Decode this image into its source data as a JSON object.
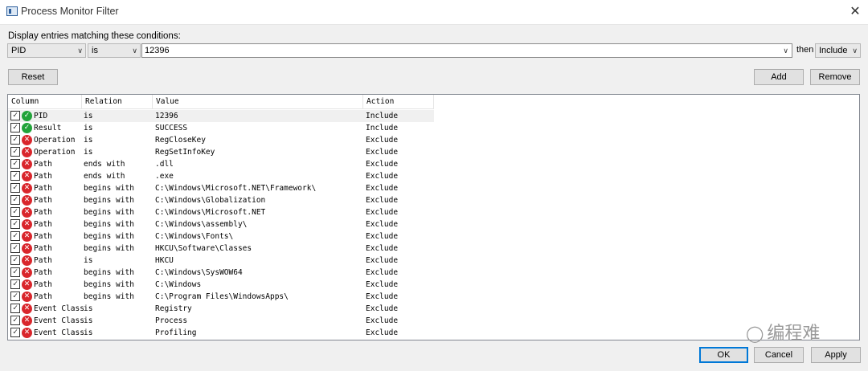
{
  "window": {
    "title": "Process Monitor Filter"
  },
  "condition": {
    "label": "Display entries matching these conditions:",
    "column_value": "PID",
    "relation_value": "is",
    "value": "12396",
    "then_label": "then",
    "action_value": "Include"
  },
  "buttons": {
    "reset": "Reset",
    "add": "Add",
    "remove": "Remove",
    "ok": "OK",
    "cancel": "Cancel",
    "apply": "Apply"
  },
  "table": {
    "headers": [
      "Column",
      "Relation",
      "Value",
      "Action"
    ],
    "rows": [
      {
        "column": "PID",
        "relation": "is",
        "value": "12396",
        "action": "Include",
        "status": "include"
      },
      {
        "column": "Result",
        "relation": "is",
        "value": "SUCCESS",
        "action": "Include",
        "status": "include"
      },
      {
        "column": "Operation",
        "relation": "is",
        "value": "RegCloseKey",
        "action": "Exclude",
        "status": "exclude"
      },
      {
        "column": "Operation",
        "relation": "is",
        "value": "RegSetInfoKey",
        "action": "Exclude",
        "status": "exclude"
      },
      {
        "column": "Path",
        "relation": "ends with",
        "value": ".dll",
        "action": "Exclude",
        "status": "exclude"
      },
      {
        "column": "Path",
        "relation": "ends with",
        "value": ".exe",
        "action": "Exclude",
        "status": "exclude"
      },
      {
        "column": "Path",
        "relation": "begins with",
        "value": "C:\\Windows\\Microsoft.NET\\Framework\\",
        "action": "Exclude",
        "status": "exclude"
      },
      {
        "column": "Path",
        "relation": "begins with",
        "value": "C:\\Windows\\Globalization",
        "action": "Exclude",
        "status": "exclude"
      },
      {
        "column": "Path",
        "relation": "begins with",
        "value": "C:\\Windows\\Microsoft.NET",
        "action": "Exclude",
        "status": "exclude"
      },
      {
        "column": "Path",
        "relation": "begins with",
        "value": "C:\\Windows\\assembly\\",
        "action": "Exclude",
        "status": "exclude"
      },
      {
        "column": "Path",
        "relation": "begins with",
        "value": "C:\\Windows\\Fonts\\",
        "action": "Exclude",
        "status": "exclude"
      },
      {
        "column": "Path",
        "relation": "begins with",
        "value": "HKCU\\Software\\Classes",
        "action": "Exclude",
        "status": "exclude"
      },
      {
        "column": "Path",
        "relation": "is",
        "value": "HKCU",
        "action": "Exclude",
        "status": "exclude"
      },
      {
        "column": "Path",
        "relation": "begins with",
        "value": "C:\\Windows\\SysWOW64",
        "action": "Exclude",
        "status": "exclude"
      },
      {
        "column": "Path",
        "relation": "begins with",
        "value": "C:\\Windows",
        "action": "Exclude",
        "status": "exclude"
      },
      {
        "column": "Path",
        "relation": "begins with",
        "value": "C:\\Program Files\\WindowsApps\\",
        "action": "Exclude",
        "status": "exclude"
      },
      {
        "column": "Event Class",
        "relation": "is",
        "value": "Registry",
        "action": "Exclude",
        "status": "exclude"
      },
      {
        "column": "Event Class",
        "relation": "is",
        "value": "Process",
        "action": "Exclude",
        "status": "exclude"
      },
      {
        "column": "Event Class",
        "relation": "is",
        "value": "Profiling",
        "action": "Exclude",
        "status": "exclude"
      }
    ]
  },
  "watermark": {
    "text": "编程难",
    "icon": "wechat-icon"
  },
  "colors": {
    "include_icon": "#22a33a",
    "exclude_icon": "#d9262c",
    "default_button_border": "#0078d7"
  }
}
